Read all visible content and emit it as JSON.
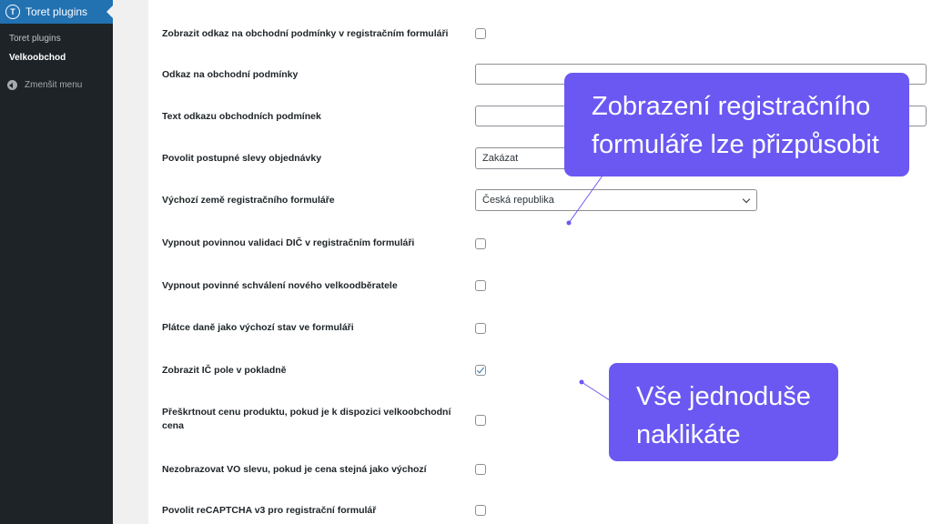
{
  "sidebar": {
    "plugin_title": "Toret plugins",
    "logo_letter": "T",
    "items": [
      {
        "label": "Toret plugins"
      },
      {
        "label": "Velkoobchod"
      }
    ],
    "collapse_label": "Zmenšit menu"
  },
  "settings": [
    {
      "label": "Zobrazit odkaz na obchodní podmínky v registračním formuláři",
      "control": "checkbox",
      "checked": false
    },
    {
      "label": "Odkaz na obchodní podmínky",
      "control": "text",
      "value": ""
    },
    {
      "label": "Text odkazu obchodních podmínek",
      "control": "text",
      "value": ""
    },
    {
      "label": "Povolit postupné slevy objednávky",
      "control": "select",
      "value": "Zakázat"
    },
    {
      "label": "Výchozí země registračního formuláře",
      "control": "select",
      "value": "Česká republika"
    },
    {
      "label": "Vypnout povinnou validaci DIČ v registračním formuláři",
      "control": "checkbox",
      "checked": false
    },
    {
      "label": "Vypnout povinné schválení nového velkoodběratele",
      "control": "checkbox",
      "checked": false
    },
    {
      "label": "Plátce daně jako výchozí stav ve formuláři",
      "control": "checkbox",
      "checked": false
    },
    {
      "label": "Zobrazit IČ pole v pokladně",
      "control": "checkbox",
      "checked": true
    },
    {
      "label": "Přeškrtnout cenu produktu, pokud je k dispozici velkoobchodní cena",
      "control": "checkbox",
      "checked": false
    },
    {
      "label": "Nezobrazovat VO slevu, pokud je cena stejná jako výchozí",
      "control": "checkbox",
      "checked": false
    },
    {
      "label": "Povolit reCAPTCHA v3 pro registrační formulář",
      "control": "checkbox",
      "checked": false
    }
  ],
  "callouts": [
    {
      "line1": "Zobrazení registračního",
      "line2": "formuláře lze přizpůsobit"
    },
    {
      "line1": "Vše jednoduše",
      "line2": "naklikáte"
    }
  ],
  "colors": {
    "sidebar_bg": "#1d2327",
    "sidebar_active": "#2271b1",
    "callout": "#6b58f2",
    "check": "#2271b1"
  }
}
